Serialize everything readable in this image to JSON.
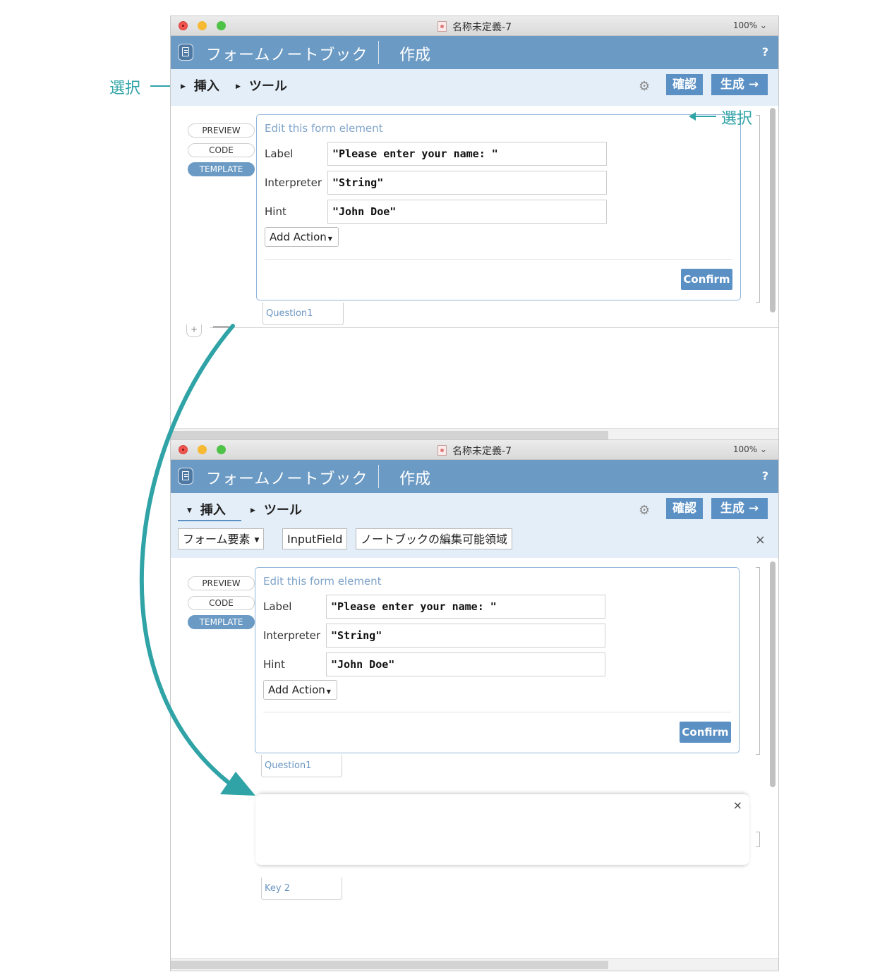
{
  "annotations": {
    "select_left": "選択",
    "select_right": "選択"
  },
  "window": {
    "title": "名称未定義-7",
    "zoom": "100% ⌄"
  },
  "app": {
    "name": "フォームノートブック",
    "mode": "作成",
    "help": "?"
  },
  "menu": {
    "insert": "挿入",
    "tools": "ツール",
    "settings_icon": "gear-icon",
    "check": "確認",
    "generate": "生成 →"
  },
  "subbar": {
    "form_elements": "フォーム要素",
    "input_field": "InputField",
    "editable_region": "ノートブックの編集可能領域",
    "close": "×"
  },
  "sidebar": {
    "preview": "PREVIEW",
    "code": "CODE",
    "template": "TEMPLATE"
  },
  "form": {
    "heading": "Edit this form element",
    "fields": [
      {
        "label": "Label",
        "value": "\"Please enter your name: \""
      },
      {
        "label": "Interpreter",
        "value": "\"String\""
      },
      {
        "label": "Hint",
        "value": "\"John Doe\""
      }
    ],
    "add_action": "Add Action",
    "confirm": "Confirm",
    "tab": "Question1"
  },
  "new_cell": {
    "close": "×",
    "tab": "Key 2"
  },
  "add_cell": "+",
  "colors": {
    "accent": "#6b9ac4",
    "button": "#5b90c4",
    "annotation": "#2fa3a6"
  }
}
